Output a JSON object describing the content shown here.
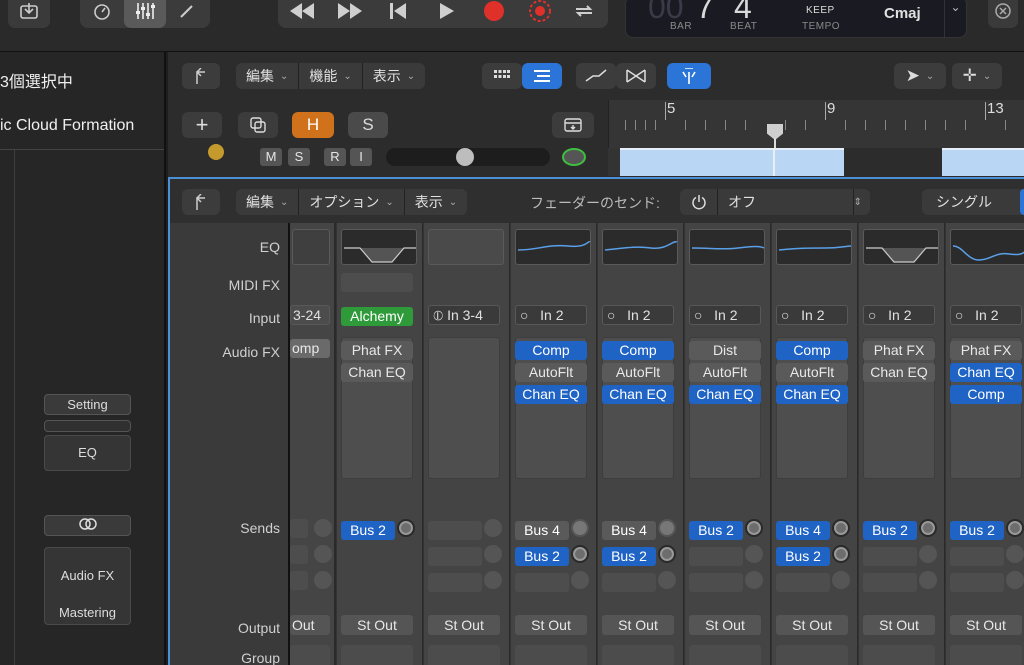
{
  "transport": {
    "lcd_bar": "00",
    "lcd_beat_prefix": "7",
    "lcd_beat": "4",
    "bar_label": "BAR",
    "beat_label": "BEAT",
    "keep_label": "KEEP",
    "tempo_label": "TEMPO",
    "key": "Cmaj"
  },
  "inspector": {
    "selection": "3個選択中",
    "region_name": "ic Cloud Formation",
    "setting_label": "Setting",
    "eq_label": "EQ",
    "audio_fx_label": "Audio FX",
    "mastering_label": "Mastering"
  },
  "tracks_toolbar": {
    "edit_menu": "編集",
    "function_menu": "機能",
    "view_menu": "表示",
    "h_button": "H",
    "s_button": "S",
    "track_m": "M",
    "track_s": "S",
    "track_r": "R",
    "track_i": "I"
  },
  "ruler": {
    "markers": [
      "5",
      "9",
      "13"
    ]
  },
  "mixer": {
    "edit_menu": "編集",
    "options_menu": "オプション",
    "view_menu": "表示",
    "fader_sends_label": "フェーダーのセンド:",
    "fader_sends_value": "オフ",
    "single_label": "シングル",
    "row_labels": {
      "eq": "EQ",
      "midi_fx": "MIDI FX",
      "input": "Input",
      "audio_fx": "Audio FX",
      "sends": "Sends",
      "output": "Output",
      "group": "Group"
    },
    "strips": [
      {
        "input": "3-24",
        "fx": [
          "omp"
        ],
        "sends": [],
        "output": "Out"
      },
      {
        "input": "Alchemy",
        "fx": [
          "Phat FX",
          "Chan EQ"
        ],
        "sends": [
          "Bus 2"
        ],
        "output": "St Out"
      },
      {
        "input": "In 3-4",
        "fx": [],
        "sends": [],
        "output": "St Out"
      },
      {
        "input": "In 2",
        "fx": [
          "Comp",
          "AutoFlt",
          "Chan EQ"
        ],
        "sends": [
          "Bus 4",
          "Bus 2"
        ],
        "output": "St Out"
      },
      {
        "input": "In 2",
        "fx": [
          "Comp",
          "AutoFlt",
          "Chan EQ"
        ],
        "sends": [
          "Bus 4",
          "Bus 2"
        ],
        "output": "St Out"
      },
      {
        "input": "In 2",
        "fx": [
          "Dist",
          "AutoFlt",
          "Chan EQ"
        ],
        "sends": [
          "Bus 2"
        ],
        "output": "St Out"
      },
      {
        "input": "In 2",
        "fx": [
          "Comp",
          "AutoFlt",
          "Chan EQ"
        ],
        "sends": [
          "Bus 4",
          "Bus 2"
        ],
        "output": "St Out"
      },
      {
        "input": "In 2",
        "fx": [
          "Phat FX",
          "Chan EQ"
        ],
        "sends": [
          "Bus 2"
        ],
        "output": "St Out"
      },
      {
        "input": "In 2",
        "fx": [
          "Phat FX",
          "Chan EQ",
          "Comp"
        ],
        "sends": [
          "Bus 2"
        ],
        "output": "St Out"
      }
    ]
  },
  "colors": {
    "accent_blue": "#1f63c4",
    "record_red": "#e0302a",
    "h_orange": "#d0711c",
    "alchemy_green": "#2e9a3a"
  }
}
